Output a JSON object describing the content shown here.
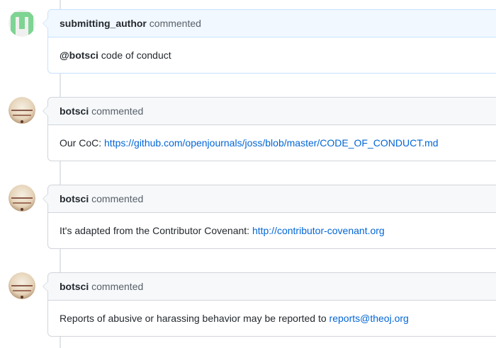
{
  "comments": [
    {
      "author": "submitting_author",
      "action": "commented",
      "mention": "@botsci",
      "text": " code of conduct",
      "avatar": "identicon-green",
      "highlight": true
    },
    {
      "author": "botsci",
      "action": "commented",
      "text": "Our CoC: ",
      "link": "https://github.com/openjournals/joss/blob/master/CODE_OF_CONDUCT.md",
      "avatar": "bot-avatar"
    },
    {
      "author": "botsci",
      "action": "commented",
      "text": "It's adapted from the Contributor Covenant: ",
      "link": "http://contributor-covenant.org",
      "avatar": "bot-avatar"
    },
    {
      "author": "botsci",
      "action": "commented",
      "text": "Reports of abusive or harassing behavior may be reported to ",
      "link": "reports@theoj.org",
      "avatar": "bot-avatar"
    }
  ],
  "colors": {
    "link": "#0366d6",
    "identicon": "#7ed492",
    "highlight_border": "#c8e1ff"
  }
}
